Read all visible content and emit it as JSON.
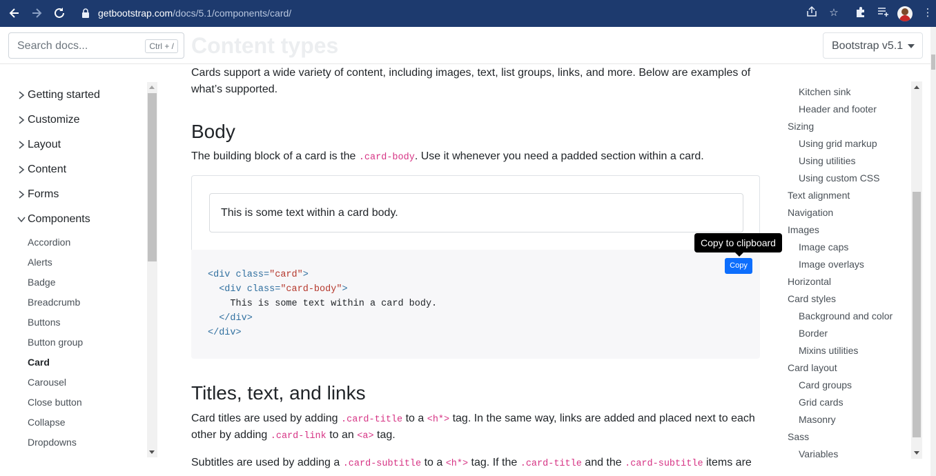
{
  "browser": {
    "url_host": "getbootstrap.com",
    "url_path": "/docs/5.1/components/card/",
    "icons": [
      "back-arrow-icon",
      "forward-arrow-icon",
      "reload-icon",
      "lock-icon",
      "share-icon",
      "star-icon",
      "extensions-icon",
      "reading-list-icon",
      "profile-avatar",
      "kebab-menu-icon"
    ]
  },
  "header": {
    "search_placeholder": "Search docs...",
    "search_shortcut": "Ctrl + /",
    "faded_title": "Content types",
    "version_label": "Bootstrap v5.1"
  },
  "sidebar": {
    "groups": [
      {
        "label": "Getting started",
        "expanded": false
      },
      {
        "label": "Customize",
        "expanded": false
      },
      {
        "label": "Layout",
        "expanded": false
      },
      {
        "label": "Content",
        "expanded": false
      },
      {
        "label": "Forms",
        "expanded": false
      },
      {
        "label": "Components",
        "expanded": true
      }
    ],
    "items": [
      "Accordion",
      "Alerts",
      "Badge",
      "Breadcrumb",
      "Buttons",
      "Button group",
      "Card",
      "Carousel",
      "Close button",
      "Collapse",
      "Dropdowns"
    ],
    "active_item": "Card"
  },
  "main": {
    "intro_line1": "Cards support a wide variety of content, including images, text, list groups, links, and more. Below are examples of",
    "intro_line2": "what’s supported.",
    "body_heading": "Body",
    "body_text_pre": "The building block of a card is the ",
    "body_code": ".card-body",
    "body_text_post": ". Use it whenever you need a padded section within a card.",
    "example_card_text": "This is some text within a card body.",
    "tooltip_text": "Copy to clipboard",
    "copy_button": "Copy",
    "code": {
      "l1_tag_open": "<div ",
      "l1_attr": "class=",
      "l1_str": "\"card\"",
      "l1_close": ">",
      "l2_tag_open": "  <div ",
      "l2_attr": "class=",
      "l2_str": "\"card-body\"",
      "l2_close": ">",
      "l3_text": "    This is some text within a card body.",
      "l4": "  </div>",
      "l5": "</div>"
    },
    "titles_heading": "Titles, text, and links",
    "titles_p1_a": "Card titles are used by adding ",
    "titles_p1_code1": ".card-title",
    "titles_p1_b": " to a ",
    "titles_p1_code2": "<h*>",
    "titles_p1_c": " tag. In the same way, links are added and placed next to each",
    "titles_p1_d": "other by adding ",
    "titles_p1_code3": ".card-link",
    "titles_p1_e": " to an ",
    "titles_p1_code4": "<a>",
    "titles_p1_f": " tag.",
    "titles_p2_a": "Subtitles are used by adding a ",
    "titles_p2_code1": ".card-subtitle",
    "titles_p2_b": " to a ",
    "titles_p2_code2": "<h*>",
    "titles_p2_c": " tag. If the ",
    "titles_p2_code3": ".card-title",
    "titles_p2_d": " and the ",
    "titles_p2_code4": ".card-subtitle",
    "titles_p2_e": " items are"
  },
  "toc": {
    "items": [
      {
        "label": "Kitchen sink",
        "level": 2
      },
      {
        "label": "Header and footer",
        "level": 2
      },
      {
        "label": "Sizing",
        "level": 1
      },
      {
        "label": "Using grid markup",
        "level": 2
      },
      {
        "label": "Using utilities",
        "level": 2
      },
      {
        "label": "Using custom CSS",
        "level": 2
      },
      {
        "label": "Text alignment",
        "level": 1
      },
      {
        "label": "Navigation",
        "level": 1
      },
      {
        "label": "Images",
        "level": 1
      },
      {
        "label": "Image caps",
        "level": 2
      },
      {
        "label": "Image overlays",
        "level": 2
      },
      {
        "label": "Horizontal",
        "level": 1
      },
      {
        "label": "Card styles",
        "level": 1
      },
      {
        "label": "Background and color",
        "level": 2
      },
      {
        "label": "Border",
        "level": 2
      },
      {
        "label": "Mixins utilities",
        "level": 2
      },
      {
        "label": "Card layout",
        "level": 1
      },
      {
        "label": "Card groups",
        "level": 2
      },
      {
        "label": "Grid cards",
        "level": 2
      },
      {
        "label": "Masonry",
        "level": 2
      },
      {
        "label": "Sass",
        "level": 1
      },
      {
        "label": "Variables",
        "level": 2
      }
    ]
  },
  "colors": {
    "chrome": "#1d3a6e",
    "copy_button": "#0d6efd",
    "code_accent": "#d63384"
  }
}
